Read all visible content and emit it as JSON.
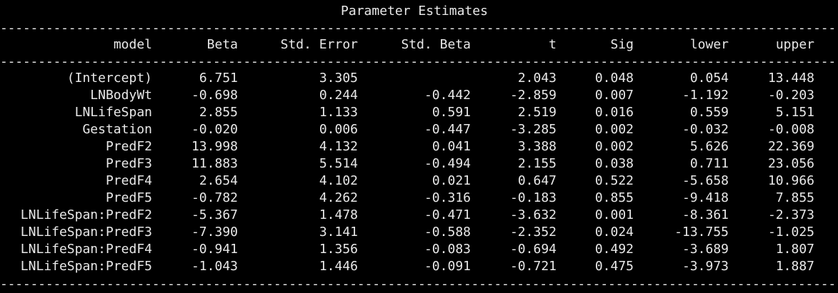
{
  "window": {
    "title": "Parameter Estimates"
  },
  "table": {
    "columns": [
      "model",
      "Beta",
      "Std. Error",
      "Std. Beta",
      "t",
      "Sig",
      "lower",
      "upper"
    ],
    "rows": [
      [
        "(Intercept)",
        "6.751",
        "3.305",
        "",
        "2.043",
        "0.048",
        "0.054",
        "13.448"
      ],
      [
        "LNBodyWt",
        "-0.698",
        "0.244",
        "-0.442",
        "-2.859",
        "0.007",
        "-1.192",
        "-0.203"
      ],
      [
        "LNLifeSpan",
        "2.855",
        "1.133",
        "0.591",
        "2.519",
        "0.016",
        "0.559",
        "5.151"
      ],
      [
        "Gestation",
        "-0.020",
        "0.006",
        "-0.447",
        "-3.285",
        "0.002",
        "-0.032",
        "-0.008"
      ],
      [
        "PredF2",
        "13.998",
        "4.132",
        "0.041",
        "3.388",
        "0.002",
        "5.626",
        "22.369"
      ],
      [
        "PredF3",
        "11.883",
        "5.514",
        "-0.494",
        "2.155",
        "0.038",
        "0.711",
        "23.056"
      ],
      [
        "PredF4",
        "2.654",
        "4.102",
        "0.021",
        "0.647",
        "0.522",
        "-5.658",
        "10.966"
      ],
      [
        "PredF5",
        "-0.782",
        "4.262",
        "-0.316",
        "-0.183",
        "0.855",
        "-9.418",
        "7.855"
      ],
      [
        "LNLifeSpan:PredF2",
        "-5.367",
        "1.478",
        "-0.471",
        "-3.632",
        "0.001",
        "-8.361",
        "-2.373"
      ],
      [
        "LNLifeSpan:PredF3",
        "-7.390",
        "3.141",
        "-0.588",
        "-2.352",
        "0.024",
        "-13.755",
        "-1.025"
      ],
      [
        "LNLifeSpan:PredF4",
        "-0.941",
        "1.356",
        "-0.083",
        "-0.694",
        "0.492",
        "-3.689",
        "1.807"
      ],
      [
        "LNLifeSpan:PredF5",
        "-1.043",
        "1.446",
        "-0.091",
        "-0.721",
        "0.475",
        "-3.973",
        "1.887"
      ]
    ]
  },
  "colors": {
    "background": "#000000",
    "text": "#e8e8e8"
  }
}
